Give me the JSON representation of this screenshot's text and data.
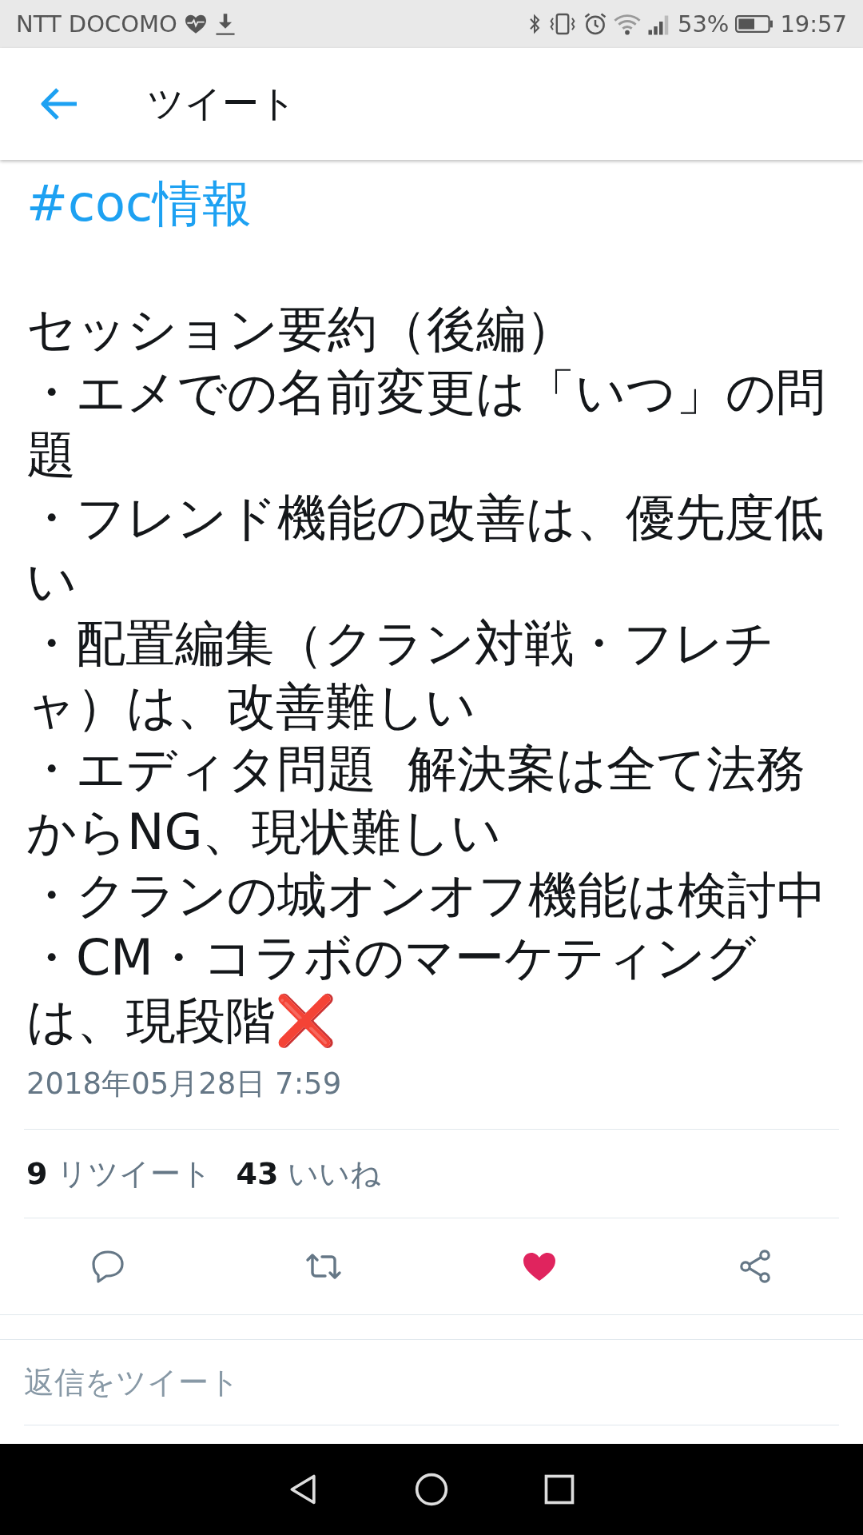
{
  "status_bar": {
    "carrier": "NTT DOCOMO",
    "battery": "53%",
    "time": "19:57"
  },
  "app_bar": {
    "title": "ツイート"
  },
  "tweet": {
    "hashtag": "#coc情報",
    "lines": [
      "セッション要約（後編）",
      "・エメでの名前変更は「いつ」の問題",
      "・フレンド機能の改善は、優先度低い",
      "・配置編集（クラン対戦・フレチャ）は、改善難しい",
      "・エディタ問題  解決案は全て法務からNG、現状難しい",
      "・クランの城オンオフ機能は検討中",
      "・CM・コラボのマーケティングは、現段階❌"
    ],
    "date": "2018年05月28日 7:59"
  },
  "stats": [
    {
      "count": "9",
      "label": "リツイート"
    },
    {
      "count": "43",
      "label": "いいね"
    }
  ],
  "actions": [
    {
      "kind": "reply"
    },
    {
      "kind": "retweet"
    },
    {
      "kind": "like",
      "liked": true
    },
    {
      "kind": "share"
    }
  ],
  "reply_field": {
    "placeholder": "返信をツイート"
  }
}
